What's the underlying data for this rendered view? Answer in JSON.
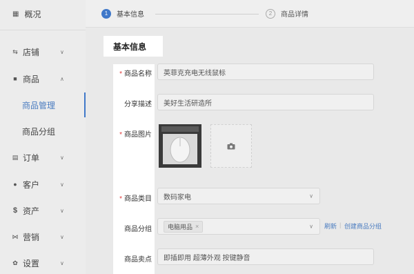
{
  "sidebar": {
    "overview": "概况",
    "items": [
      {
        "label": "店铺",
        "icon": "filter-icon"
      },
      {
        "label": "商品",
        "icon": "box-icon"
      },
      {
        "label": "订单",
        "icon": "order-icon"
      },
      {
        "label": "客户",
        "icon": "user-icon"
      },
      {
        "label": "资产",
        "icon": "dollar-icon"
      },
      {
        "label": "营销",
        "icon": "marketing-icon"
      },
      {
        "label": "设置",
        "icon": "gear-icon"
      }
    ],
    "sub_items": [
      "商品管理",
      "商品分组"
    ]
  },
  "steps": [
    {
      "num": "1",
      "label": "基本信息"
    },
    {
      "num": "2",
      "label": "商品详情"
    }
  ],
  "form": {
    "section_title": "基本信息",
    "fields": {
      "name": {
        "label": "商品名称",
        "value": "英菲克充电无线鼠标"
      },
      "share": {
        "label": "分享描述",
        "value": "美好生活研造所"
      },
      "image": {
        "label": "商品图片"
      },
      "category": {
        "label": "商品类目",
        "value": "数码家电"
      },
      "group": {
        "label": "商品分组",
        "tag": "电脑用品",
        "tag_close": "×"
      },
      "selling": {
        "label": "商品卖点",
        "value": "即插即用 超薄外观 按键静音"
      }
    },
    "links": {
      "refresh": "刷新",
      "sep": "|",
      "create_group": "创建商品分组"
    }
  },
  "colors": {
    "accent": "#3f78c9",
    "required": "#e23b3b"
  }
}
